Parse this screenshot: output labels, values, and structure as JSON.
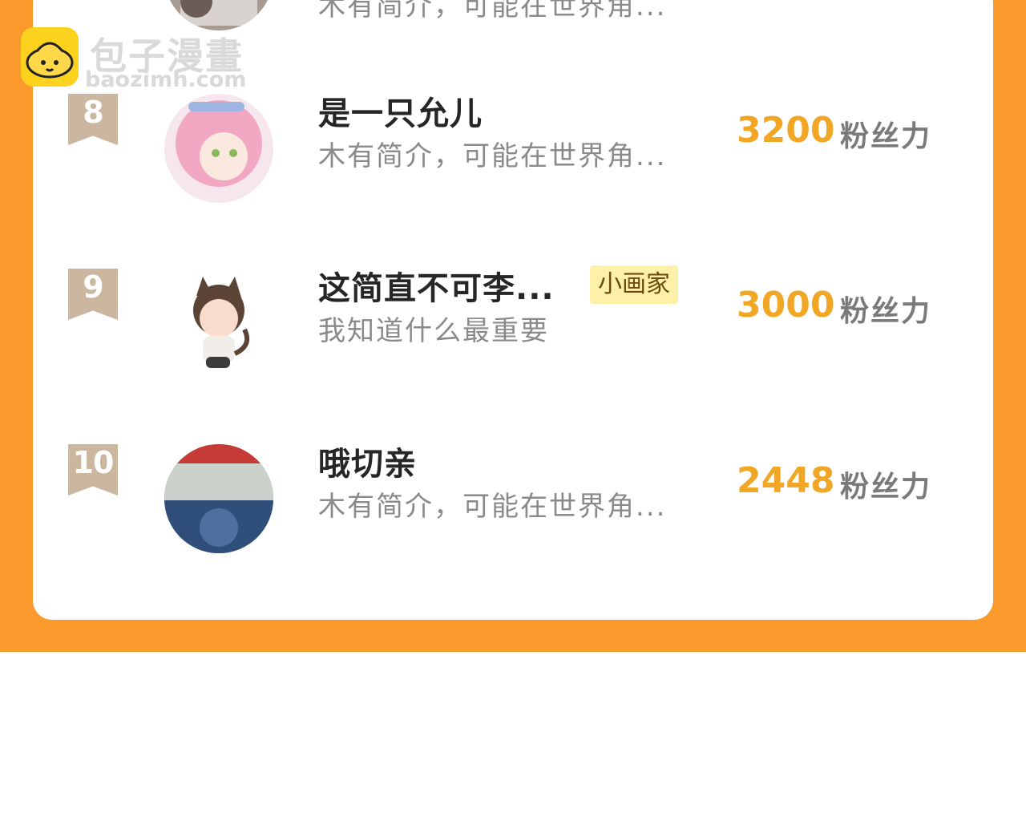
{
  "watermark": {
    "title": "包子漫畫",
    "url": "baozimh.com"
  },
  "fans_unit": "粉丝力",
  "rows": [
    {
      "rank": "",
      "name": "",
      "tag": "",
      "bio": "木有简介，可能在世界角...",
      "fans": ""
    },
    {
      "rank": "8",
      "name": "是一只允儿",
      "tag": "",
      "bio": "木有简介，可能在世界角...",
      "fans": "3200"
    },
    {
      "rank": "9",
      "name": "这简直不可李...",
      "tag": "小画家",
      "bio": "我知道什么最重要",
      "fans": "3000"
    },
    {
      "rank": "10",
      "name": "哦切亲",
      "tag": "",
      "bio": "木有简介，可能在世界角...",
      "fans": "2448"
    }
  ],
  "colors": {
    "accent_orange": "#fb9a2c",
    "fans_gold": "#f2a626",
    "badge_tan": "#cbb7a0",
    "tag_yellow": "#fdf0a8"
  }
}
